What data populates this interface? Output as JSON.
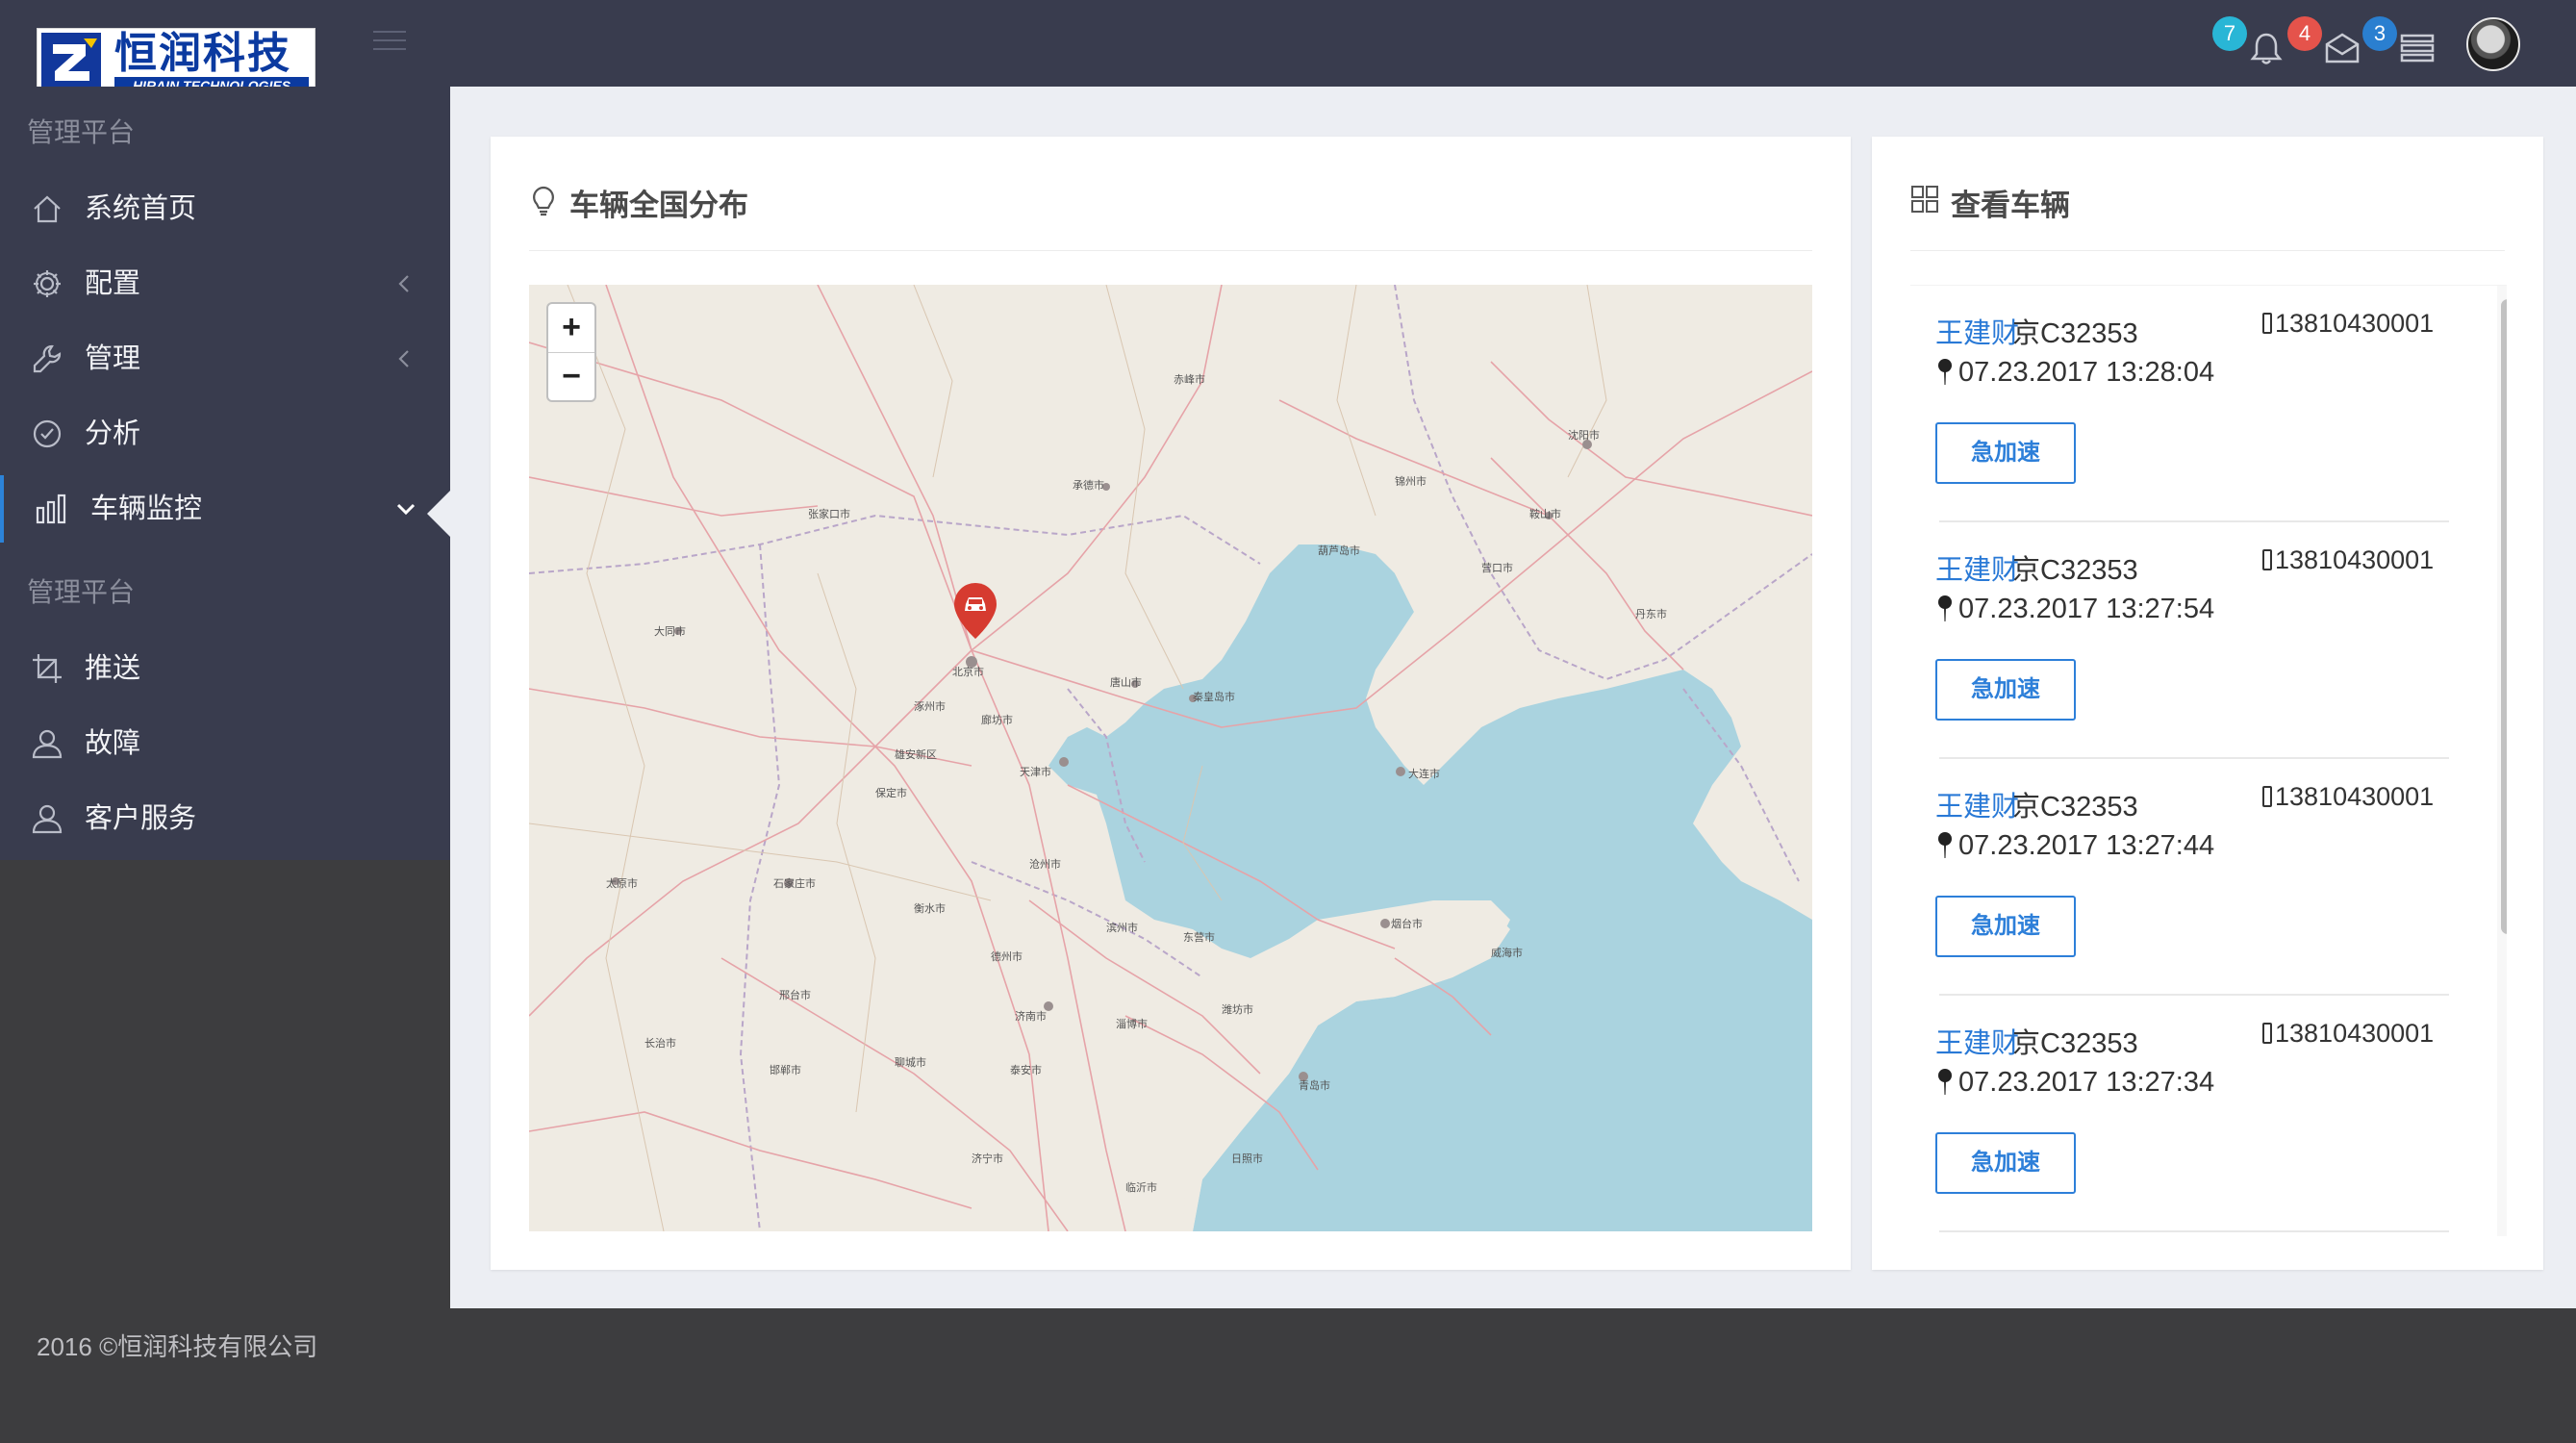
{
  "header": {
    "logo_cn": "恒润科技",
    "logo_en": "HIRAIN TECHNOLOGIES",
    "badges": [
      {
        "icon": "bell-icon",
        "count": "7",
        "color": "#29b6d6"
      },
      {
        "icon": "mail-icon",
        "count": "4",
        "color": "#e5534b"
      },
      {
        "icon": "tasks-icon",
        "count": "3",
        "color": "#2a7fd0"
      }
    ]
  },
  "sidebar": {
    "section1": "管理平台",
    "section2": "管理平台",
    "items": [
      {
        "label": "系统首页",
        "icon": "home-icon"
      },
      {
        "label": "配置",
        "icon": "gear-icon",
        "chevron": "left"
      },
      {
        "label": "管理",
        "icon": "wrench-icon",
        "chevron": "left"
      },
      {
        "label": "分析",
        "icon": "check-circle-icon"
      },
      {
        "label": "车辆监控",
        "icon": "bar-chart-icon",
        "chevron": "down",
        "active": true
      },
      {
        "label": "推送",
        "icon": "crop-icon"
      },
      {
        "label": "故障",
        "icon": "user-icon"
      },
      {
        "label": "客户服务",
        "icon": "user-icon"
      }
    ]
  },
  "map_card": {
    "title": "车辆全国分布",
    "zoom_in": "+",
    "zoom_out": "−",
    "labels": {
      "beijing": "北京市",
      "tianjin": "天津市",
      "shijiazhuang": "石家庄市",
      "jinan": "济南市",
      "dalian": "大连市",
      "yantai": "烟台市",
      "qingdao": "青岛市",
      "zhangjiakou": "张家口市",
      "chengde": "承德市",
      "tangshan": "唐山市",
      "qinhuangdao": "秦皇岛市",
      "shenyang": "沈阳市",
      "anshan": "鞍山市",
      "dandong": "丹东市",
      "baoding": "保定市",
      "cangzhou": "沧州市",
      "hengshui": "衡水市",
      "dezhou": "德州市",
      "binzhou": "滨州市",
      "dongying": "东营市",
      "weifang": "潍坊市",
      "linyi": "临沂市",
      "zibo": "淄博市",
      "taian": "泰安市",
      "datong": "大同市",
      "taiyuan": "太原市",
      "xingtai": "邢台市",
      "handan": "邯郸市",
      "liaocheng": "聊城市",
      "jining": "济宁市",
      "rizhao": "日照市",
      "weihai": "威海市",
      "chifeng": "赤峰市",
      "huludao": "葫芦岛市",
      "jinzhou": "锦州市",
      "yingkou": "营口市",
      "langfang": "廊坊市",
      "xiongan": "雄安新区",
      "zhuozhou": "涿州市",
      "changzhi": "长治市"
    }
  },
  "vehicles_card": {
    "title": "查看车辆",
    "vehicles": [
      {
        "driver": "王建财",
        "plate": "京C32353",
        "phone": "13810430001",
        "time": "07.23.2017 13:28:04",
        "action": "急加速"
      },
      {
        "driver": "王建财",
        "plate": "京C32353",
        "phone": "13810430001",
        "time": "07.23.2017 13:27:54",
        "action": "急加速"
      },
      {
        "driver": "王建财",
        "plate": "京C32353",
        "phone": "13810430001",
        "time": "07.23.2017 13:27:44",
        "action": "急加速"
      },
      {
        "driver": "王建财",
        "plate": "京C32353",
        "phone": "13810430001",
        "time": "07.23.2017 13:27:34",
        "action": "急加速"
      }
    ]
  },
  "footer": {
    "copyright": "2016 ©恒润科技有限公司"
  }
}
